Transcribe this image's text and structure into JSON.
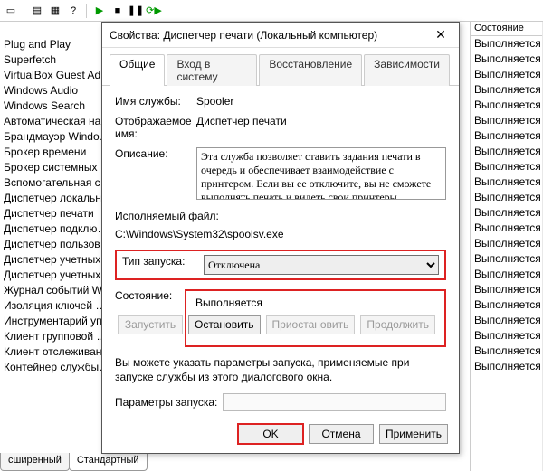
{
  "toolbar": {
    "icons": [
      "sheet",
      "props",
      "export",
      "help",
      "play",
      "stop",
      "pause",
      "restart"
    ]
  },
  "columns": {
    "state_header": "Состояние"
  },
  "services": [
    "",
    "Plug and Play",
    "Superfetch",
    "VirtualBox Guest Ad…",
    "Windows Audio",
    "Windows Search",
    "Автоматическая на…",
    "Брандмауэр Windo…",
    "Брокер времени",
    "Брокер системных …",
    "Вспомогательная с…",
    "Диспетчер локальн…",
    "Диспетчер печати",
    "Диспетчер подклю…",
    "Диспетчер пользов…",
    "Диспетчер учетных…",
    "Диспетчер учетных…",
    "Журнал событий W…",
    "Изоляция ключей …",
    "Инструментарий уп…",
    "Клиент групповой …",
    "Клиент отслеживан…",
    "Контейнер службы…"
  ],
  "states": [
    "",
    "Выполняется",
    "Выполняется",
    "Выполняется",
    "Выполняется",
    "Выполняется",
    "Выполняется",
    "Выполняется",
    "Выполняется",
    "Выполняется",
    "Выполняется",
    "Выполняется",
    "Выполняется",
    "Выполняется",
    "Выполняется",
    "Выполняется",
    "Выполняется",
    "Выполняется",
    "Выполняется",
    "Выполняется",
    "Выполняется",
    "Выполняется",
    "Выполняется"
  ],
  "bottom_tabs": {
    "extended": "сширенный",
    "standard": "Стандартный"
  },
  "dialog": {
    "title": "Свойства: Диспетчер печати (Локальный компьютер)",
    "tabs": {
      "general": "Общие",
      "logon": "Вход в систему",
      "recovery": "Восстановление",
      "deps": "Зависимости"
    },
    "labels": {
      "svcname": "Имя службы:",
      "display": "Отображаемое имя:",
      "desc": "Описание:",
      "execfile": "Исполняемый файл:",
      "startup": "Тип запуска:",
      "status": "Состояние:",
      "params": "Параметры запуска:"
    },
    "values": {
      "svcname": "Spooler",
      "display": "Диспетчер печати",
      "desc": "Эта служба позволяет ставить задания печати в очередь и обеспечивает взаимодействие с принтером. Если вы ее отключите, вы не сможете выполнять печать и видеть свои принтеры.",
      "execfile": "C:\\Windows\\System32\\spoolsv.exe",
      "startup_selected": "Отключена",
      "status": "Выполняется"
    },
    "buttons": {
      "start": "Запустить",
      "stop": "Остановить",
      "pause": "Приостановить",
      "resume": "Продолжить",
      "ok": "OK",
      "cancel": "Отмена",
      "apply": "Применить"
    },
    "hint": "Вы можете указать параметры запуска, применяемые при запуске службы из этого диалогового окна."
  }
}
